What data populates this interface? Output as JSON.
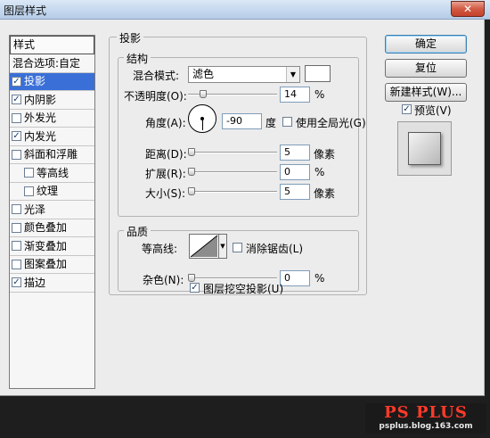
{
  "window": {
    "title": "图层样式",
    "close_label": "✕"
  },
  "styles_panel": {
    "header": "样式",
    "items": [
      {
        "label": "混合选项:自定",
        "checkbox": false,
        "checked": false,
        "selected": false
      },
      {
        "label": "投影",
        "checkbox": true,
        "checked": true,
        "selected": true
      },
      {
        "label": "内阴影",
        "checkbox": true,
        "checked": true,
        "selected": false
      },
      {
        "label": "外发光",
        "checkbox": true,
        "checked": false,
        "selected": false
      },
      {
        "label": "内发光",
        "checkbox": true,
        "checked": true,
        "selected": false
      },
      {
        "label": "斜面和浮雕",
        "checkbox": true,
        "checked": false,
        "selected": false
      },
      {
        "label": "等高线",
        "checkbox": true,
        "checked": false,
        "selected": false,
        "sub": true
      },
      {
        "label": "纹理",
        "checkbox": true,
        "checked": false,
        "selected": false,
        "sub": true
      },
      {
        "label": "光泽",
        "checkbox": true,
        "checked": false,
        "selected": false
      },
      {
        "label": "颜色叠加",
        "checkbox": true,
        "checked": false,
        "selected": false
      },
      {
        "label": "渐变叠加",
        "checkbox": true,
        "checked": false,
        "selected": false
      },
      {
        "label": "图案叠加",
        "checkbox": true,
        "checked": false,
        "selected": false
      },
      {
        "label": "描边",
        "checkbox": true,
        "checked": true,
        "selected": false
      }
    ]
  },
  "drop_shadow": {
    "group_title": "投影",
    "structure": {
      "title": "结构",
      "blend_mode_label": "混合模式:",
      "blend_mode_value": "滤色",
      "shadow_color": "#ffffff",
      "opacity_label": "不透明度(O):",
      "opacity_value": "14",
      "opacity_percent": 14,
      "opacity_unit": "%",
      "angle_label": "角度(A):",
      "angle_value": "-90",
      "angle_unit": "度",
      "global_light_label": "使用全局光(G)",
      "global_light_checked": false,
      "distance_label": "距离(D):",
      "distance_value": "5",
      "distance_unit": "像素",
      "spread_label": "扩展(R):",
      "spread_value": "0",
      "spread_unit": "%",
      "size_label": "大小(S):",
      "size_value": "5",
      "size_unit": "像素"
    },
    "quality": {
      "title": "品质",
      "contour_label": "等高线:",
      "antialias_label": "消除锯齿(L)",
      "antialias_checked": false,
      "noise_label": "杂色(N):",
      "noise_value": "0",
      "noise_unit": "%"
    },
    "knockout_label": "图层挖空投影(U)",
    "knockout_checked": true
  },
  "buttons": {
    "ok": "确定",
    "reset": "复位",
    "new_style": "新建样式(W)...",
    "preview_label": "预览(V)",
    "preview_checked": true
  },
  "watermark": {
    "title": "PS PLUS",
    "url": "psplus.blog.163.com"
  }
}
